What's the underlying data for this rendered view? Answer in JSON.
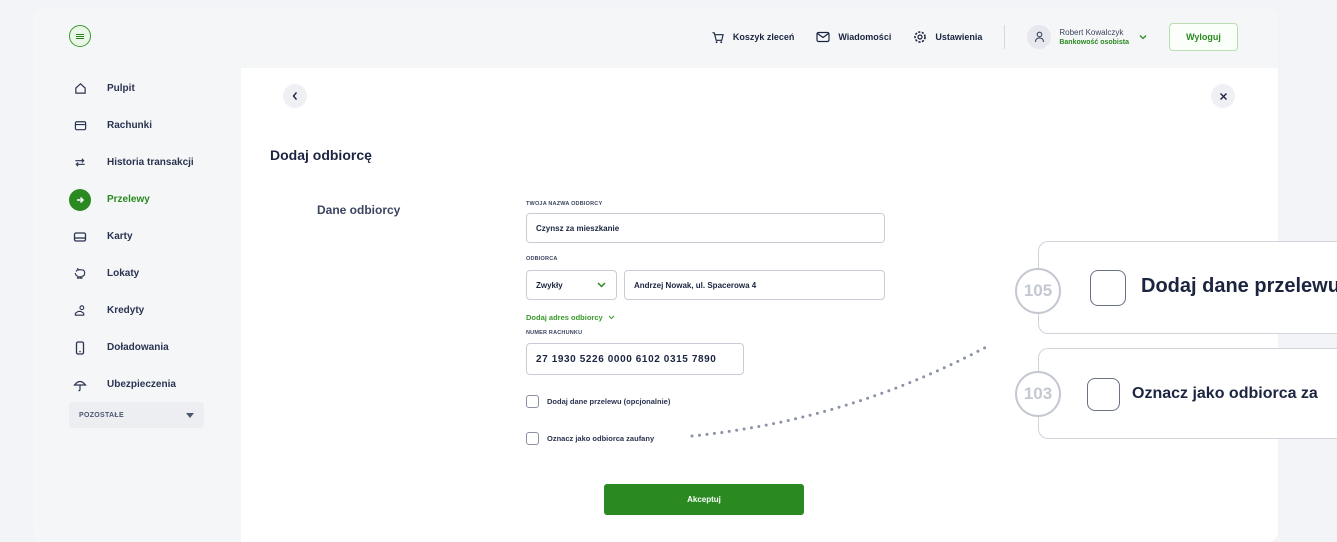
{
  "sidebar": {
    "items": [
      {
        "label": "Pulpit",
        "icon": "home-icon",
        "active": false
      },
      {
        "label": "Rachunki",
        "icon": "wallet-icon",
        "active": false
      },
      {
        "label": "Historia transakcji",
        "icon": "arrows-exchange-icon",
        "active": false
      },
      {
        "label": "Przelewy",
        "icon": "transfer-arrow-icon",
        "active": true
      },
      {
        "label": "Karty",
        "icon": "card-icon",
        "active": false
      },
      {
        "label": "Lokaty",
        "icon": "piggy-bank-icon",
        "active": false
      },
      {
        "label": "Kredyty",
        "icon": "coins-icon",
        "active": false
      },
      {
        "label": "Doładowania",
        "icon": "phone-icon",
        "active": false
      },
      {
        "label": "Ubezpieczenia",
        "icon": "umbrella-icon",
        "active": false
      }
    ],
    "more_label": "POZOSTAŁE"
  },
  "topbar": {
    "cart_label": "Koszyk zleceń",
    "messages_label": "Wiadomości",
    "settings_label": "Ustawienia",
    "user_name": "Robert Kowalczyk",
    "user_context": "Bankowość osobista",
    "logout_label": "Wyloguj"
  },
  "form": {
    "page_title": "Dodaj odbiorcę",
    "section_title": "Dane odbiorcy",
    "name_label": "TWOJA NAZWA ODBIORCY",
    "name_value": "Czynsz za mieszkanie",
    "recipient_label": "ODBIORCA",
    "recipient_type": "Zwykły",
    "recipient_value": "Andrzej Nowak, ul. Spacerowa 4",
    "add_address_label": "Dodaj adres odbiorcy",
    "account_label": "NUMER RACHUNKU",
    "account_value": "27 1930 5226 0000 6102 0315 7890",
    "checkbox_transfer_label": "Dodaj dane przelewu (opcjonalnie)",
    "checkbox_trusted_label": "Oznacz jako odbiorca zaufany",
    "accept_label": "Akceptuj"
  },
  "callouts": [
    {
      "number": "105",
      "label": "Dodaj dane przelewu"
    },
    {
      "number": "103",
      "label": "Oznacz jako odbiorca za"
    }
  ],
  "colors": {
    "brand_green": "#2a8a21",
    "text_dark": "#1b2540"
  }
}
